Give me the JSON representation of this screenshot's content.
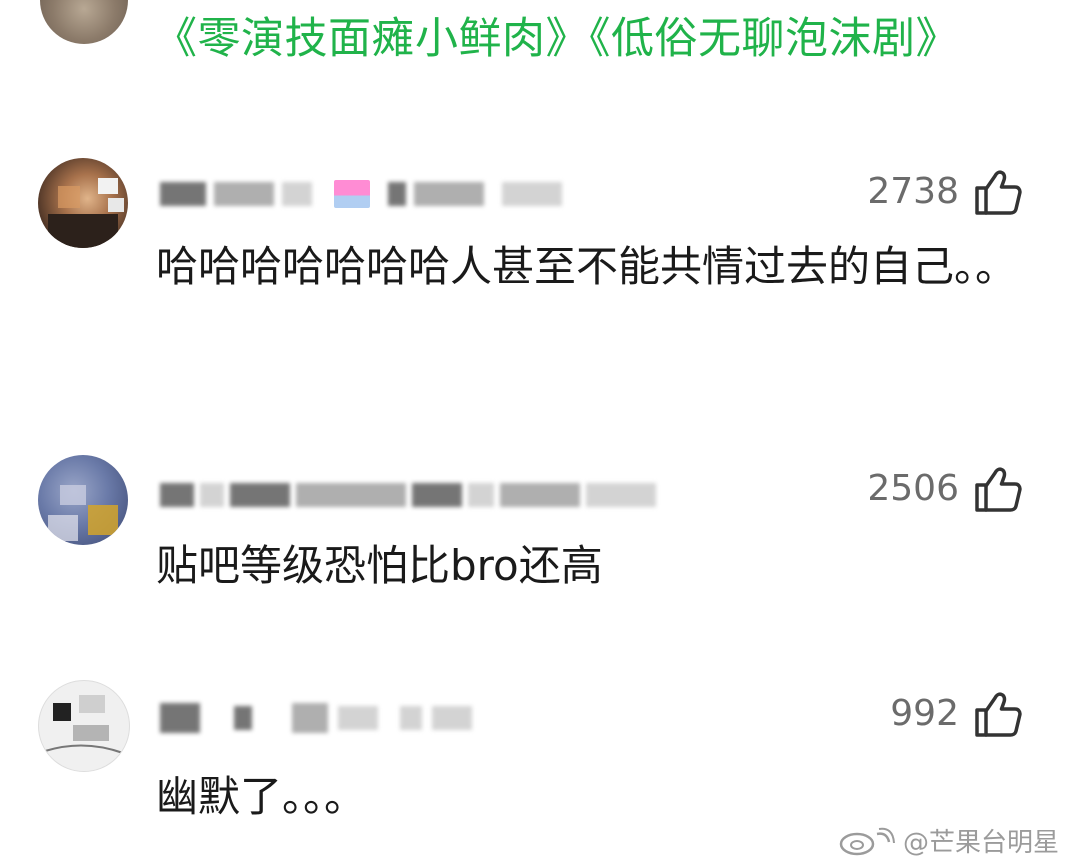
{
  "top": {
    "link_text": "《零演技面瘫小鲜肉》《低俗无聊泡沫剧》"
  },
  "comments": [
    {
      "likes": "2738",
      "text": "哈哈哈哈哈哈哈人甚至不能共情过去的自己。。"
    },
    {
      "likes": "2506",
      "text": "贴吧等级恐怕比bro还高"
    },
    {
      "likes": "992",
      "text": "幽默了。。。"
    }
  ],
  "icons": {
    "like": "thumbs-up-icon",
    "watermark": "weibo-logo-icon"
  },
  "watermark": {
    "text": "@芒果台明星"
  },
  "colors": {
    "link": "#20b34a",
    "text": "#1a1a1a",
    "count": "#6b6b6b"
  }
}
